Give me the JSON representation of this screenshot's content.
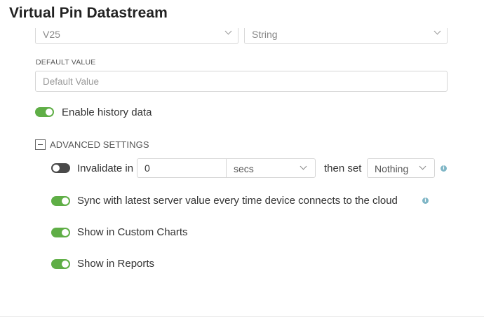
{
  "header": {
    "title": "Virtual Pin Datastream"
  },
  "top_selects": {
    "pin_value": "V25",
    "type_value": "String"
  },
  "default_value": {
    "label": "DEFAULT VALUE",
    "placeholder": "Default Value",
    "value": ""
  },
  "history": {
    "label": "Enable history data",
    "enabled": true
  },
  "advanced": {
    "label": "ADVANCED SETTINGS",
    "expanded": true,
    "invalidate": {
      "label": "Invalidate in",
      "enabled": false,
      "value": "0",
      "unit": "secs",
      "then_label": "then set",
      "action": "Nothing"
    },
    "sync": {
      "label": "Sync with latest server value every time device connects to the cloud",
      "enabled": true
    },
    "custom_charts": {
      "label": "Show in Custom Charts",
      "enabled": true
    },
    "reports": {
      "label": "Show in Reports",
      "enabled": true
    }
  },
  "colors": {
    "toggle_on": "#5fae46",
    "toggle_off": "#4a4a4a",
    "info": "#7fb6c6"
  },
  "icons": {
    "info": "info-icon",
    "chevron": "chevron-down-icon",
    "collapse": "minus-square-icon"
  }
}
